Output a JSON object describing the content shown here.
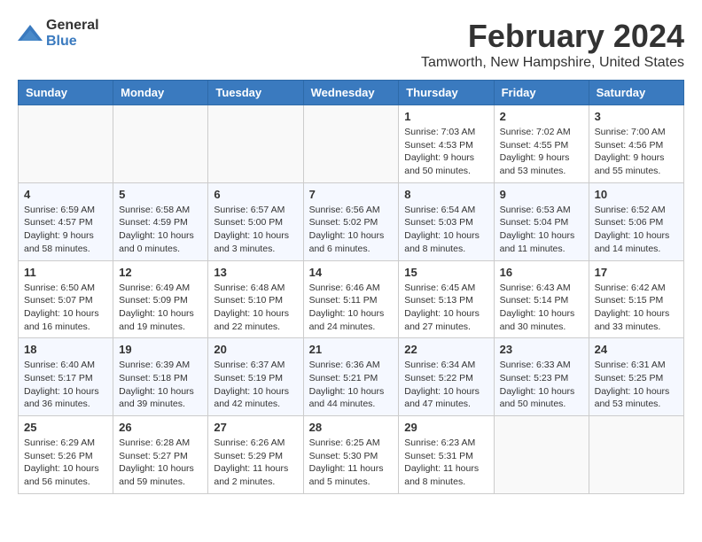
{
  "logo": {
    "general": "General",
    "blue": "Blue"
  },
  "header": {
    "month_year": "February 2024",
    "location": "Tamworth, New Hampshire, United States"
  },
  "weekdays": [
    "Sunday",
    "Monday",
    "Tuesday",
    "Wednesday",
    "Thursday",
    "Friday",
    "Saturday"
  ],
  "weeks": [
    [
      {
        "day": "",
        "info": ""
      },
      {
        "day": "",
        "info": ""
      },
      {
        "day": "",
        "info": ""
      },
      {
        "day": "",
        "info": ""
      },
      {
        "day": "1",
        "info": "Sunrise: 7:03 AM\nSunset: 4:53 PM\nDaylight: 9 hours\nand 50 minutes."
      },
      {
        "day": "2",
        "info": "Sunrise: 7:02 AM\nSunset: 4:55 PM\nDaylight: 9 hours\nand 53 minutes."
      },
      {
        "day": "3",
        "info": "Sunrise: 7:00 AM\nSunset: 4:56 PM\nDaylight: 9 hours\nand 55 minutes."
      }
    ],
    [
      {
        "day": "4",
        "info": "Sunrise: 6:59 AM\nSunset: 4:57 PM\nDaylight: 9 hours\nand 58 minutes."
      },
      {
        "day": "5",
        "info": "Sunrise: 6:58 AM\nSunset: 4:59 PM\nDaylight: 10 hours\nand 0 minutes."
      },
      {
        "day": "6",
        "info": "Sunrise: 6:57 AM\nSunset: 5:00 PM\nDaylight: 10 hours\nand 3 minutes."
      },
      {
        "day": "7",
        "info": "Sunrise: 6:56 AM\nSunset: 5:02 PM\nDaylight: 10 hours\nand 6 minutes."
      },
      {
        "day": "8",
        "info": "Sunrise: 6:54 AM\nSunset: 5:03 PM\nDaylight: 10 hours\nand 8 minutes."
      },
      {
        "day": "9",
        "info": "Sunrise: 6:53 AM\nSunset: 5:04 PM\nDaylight: 10 hours\nand 11 minutes."
      },
      {
        "day": "10",
        "info": "Sunrise: 6:52 AM\nSunset: 5:06 PM\nDaylight: 10 hours\nand 14 minutes."
      }
    ],
    [
      {
        "day": "11",
        "info": "Sunrise: 6:50 AM\nSunset: 5:07 PM\nDaylight: 10 hours\nand 16 minutes."
      },
      {
        "day": "12",
        "info": "Sunrise: 6:49 AM\nSunset: 5:09 PM\nDaylight: 10 hours\nand 19 minutes."
      },
      {
        "day": "13",
        "info": "Sunrise: 6:48 AM\nSunset: 5:10 PM\nDaylight: 10 hours\nand 22 minutes."
      },
      {
        "day": "14",
        "info": "Sunrise: 6:46 AM\nSunset: 5:11 PM\nDaylight: 10 hours\nand 24 minutes."
      },
      {
        "day": "15",
        "info": "Sunrise: 6:45 AM\nSunset: 5:13 PM\nDaylight: 10 hours\nand 27 minutes."
      },
      {
        "day": "16",
        "info": "Sunrise: 6:43 AM\nSunset: 5:14 PM\nDaylight: 10 hours\nand 30 minutes."
      },
      {
        "day": "17",
        "info": "Sunrise: 6:42 AM\nSunset: 5:15 PM\nDaylight: 10 hours\nand 33 minutes."
      }
    ],
    [
      {
        "day": "18",
        "info": "Sunrise: 6:40 AM\nSunset: 5:17 PM\nDaylight: 10 hours\nand 36 minutes."
      },
      {
        "day": "19",
        "info": "Sunrise: 6:39 AM\nSunset: 5:18 PM\nDaylight: 10 hours\nand 39 minutes."
      },
      {
        "day": "20",
        "info": "Sunrise: 6:37 AM\nSunset: 5:19 PM\nDaylight: 10 hours\nand 42 minutes."
      },
      {
        "day": "21",
        "info": "Sunrise: 6:36 AM\nSunset: 5:21 PM\nDaylight: 10 hours\nand 44 minutes."
      },
      {
        "day": "22",
        "info": "Sunrise: 6:34 AM\nSunset: 5:22 PM\nDaylight: 10 hours\nand 47 minutes."
      },
      {
        "day": "23",
        "info": "Sunrise: 6:33 AM\nSunset: 5:23 PM\nDaylight: 10 hours\nand 50 minutes."
      },
      {
        "day": "24",
        "info": "Sunrise: 6:31 AM\nSunset: 5:25 PM\nDaylight: 10 hours\nand 53 minutes."
      }
    ],
    [
      {
        "day": "25",
        "info": "Sunrise: 6:29 AM\nSunset: 5:26 PM\nDaylight: 10 hours\nand 56 minutes."
      },
      {
        "day": "26",
        "info": "Sunrise: 6:28 AM\nSunset: 5:27 PM\nDaylight: 10 hours\nand 59 minutes."
      },
      {
        "day": "27",
        "info": "Sunrise: 6:26 AM\nSunset: 5:29 PM\nDaylight: 11 hours\nand 2 minutes."
      },
      {
        "day": "28",
        "info": "Sunrise: 6:25 AM\nSunset: 5:30 PM\nDaylight: 11 hours\nand 5 minutes."
      },
      {
        "day": "29",
        "info": "Sunrise: 6:23 AM\nSunset: 5:31 PM\nDaylight: 11 hours\nand 8 minutes."
      },
      {
        "day": "",
        "info": ""
      },
      {
        "day": "",
        "info": ""
      }
    ]
  ]
}
